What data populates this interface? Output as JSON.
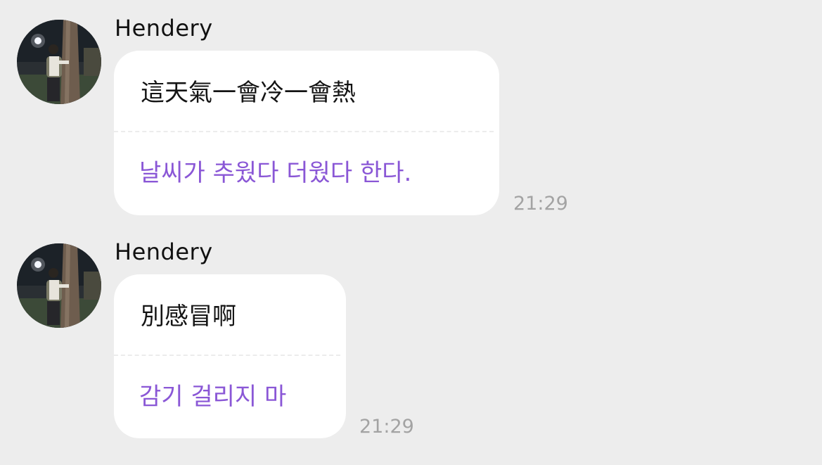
{
  "messages": [
    {
      "sender": "Hendery",
      "original": "這天氣一會冷一會熱",
      "translation": "날씨가 추웠다 더웠다 한다.",
      "time": "21:29"
    },
    {
      "sender": "Hendery",
      "original": "別感冒啊",
      "translation": "감기 걸리지 마",
      "time": "21:29"
    }
  ],
  "colors": {
    "background": "#ededed",
    "bubble": "#ffffff",
    "translation_text": "#8a57d6",
    "timestamp": "#a3a3a3"
  },
  "icons": {
    "avatar": "profile-photo-person-hugging-tree-at-night"
  }
}
